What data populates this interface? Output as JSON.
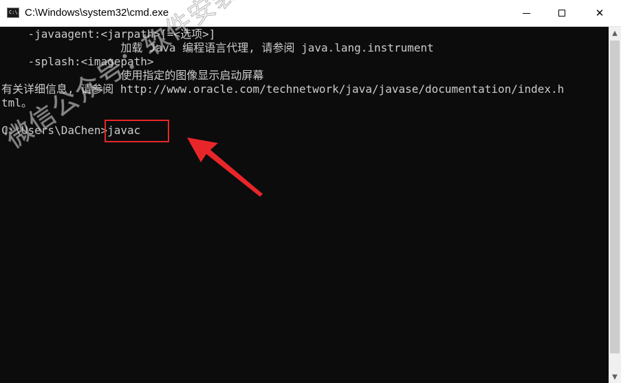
{
  "window": {
    "title": "C:\\Windows\\system32\\cmd.exe",
    "icon_text": "C:\\.",
    "minimize_icon": "minimize-icon",
    "maximize_icon": "maximize-icon",
    "close_glyph": "✕"
  },
  "console": {
    "lines": [
      "    -javaagent:<jarpath>[=<选项>]",
      "                  加载 Java 编程语言代理, 请参阅 java.lang.instrument",
      "    -splash:<imagepath>",
      "                  使用指定的图像显示启动屏幕",
      "有关详细信息, 请参阅 http://www.oracle.com/technetwork/java/javase/documentation/index.h",
      "tml。",
      "",
      "C:\\Users\\DaChen>javac"
    ]
  },
  "scrollbar": {
    "up_glyph": "▲",
    "down_glyph": "▼"
  },
  "watermark": {
    "text": "微信公众号：软件安装管家"
  },
  "annotation": {
    "box_color": "#e8262a",
    "arrow_color": "#e8262a"
  }
}
